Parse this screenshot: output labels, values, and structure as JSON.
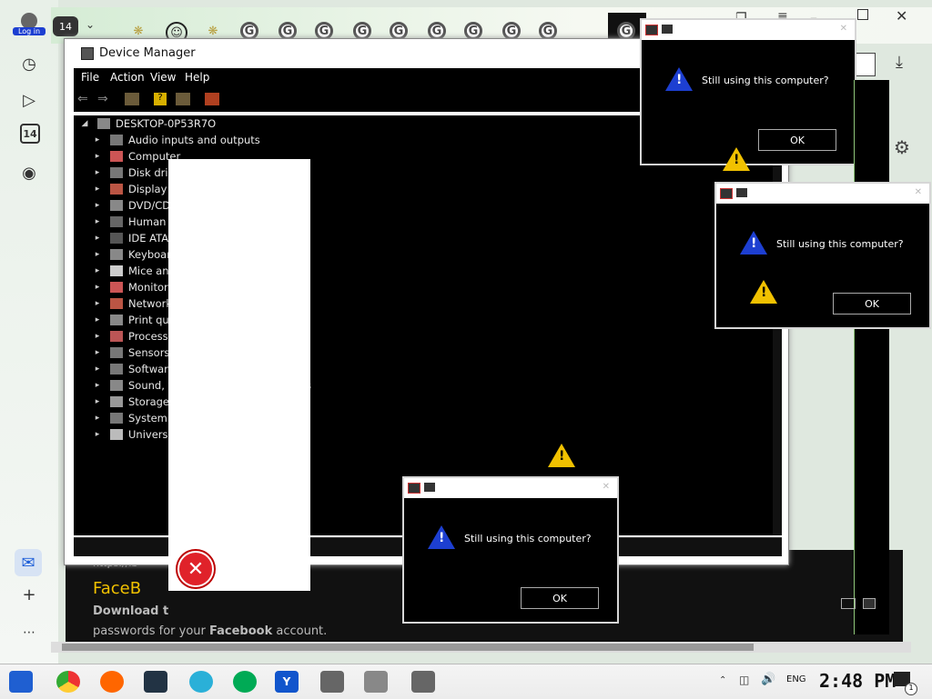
{
  "browser": {
    "login_label": "Log in",
    "tab_count": "14",
    "rail_badge": "14",
    "side_icons": [
      "clock-icon",
      "play-icon",
      "calendar-icon",
      "camera-icon"
    ],
    "bottom_icons": [
      "mail-icon",
      "plus-icon",
      "more-icon"
    ]
  },
  "device_manager": {
    "title": "Device Manager",
    "menu": [
      "File",
      "Action",
      "View",
      "Help"
    ],
    "root": "DESKTOP-0P53R7O",
    "items": [
      "Audio inputs and outputs",
      "Computer",
      "Disk drives",
      "Display adapters",
      "DVD/CD-ROM drives",
      "Human Interface Devices",
      "IDE ATA/ATAPI controllers",
      "Keyboards",
      "Mice and other pointing devices",
      "Monitors",
      "Network adapters",
      "Print queues",
      "Processors",
      "Sensors",
      "Software devices",
      "Sound, video and game controllers",
      "Storage controllers",
      "System devices",
      "Universal Serial Bus controllers"
    ]
  },
  "dialogs": [
    {
      "message": "Still using this computer?",
      "ok": "OK"
    },
    {
      "message": "Still using this computer?",
      "ok": "OK"
    },
    {
      "message": "Still using this computer?",
      "ok": "OK"
    }
  ],
  "page_behind": {
    "url_fragment": "https://lb",
    "heading": "FaceB",
    "line1": "Download t",
    "line2_pre": "passwords for your ",
    "line2_bold": "Facebook",
    "line2_post": " account."
  },
  "taskbar": {
    "lang": "ENG",
    "clock": "2:48 PM",
    "notification_count": "1"
  },
  "colors": {
    "accent": "#1d3fd1",
    "warning": "#f1c100",
    "dialog_bg": "#000000"
  }
}
